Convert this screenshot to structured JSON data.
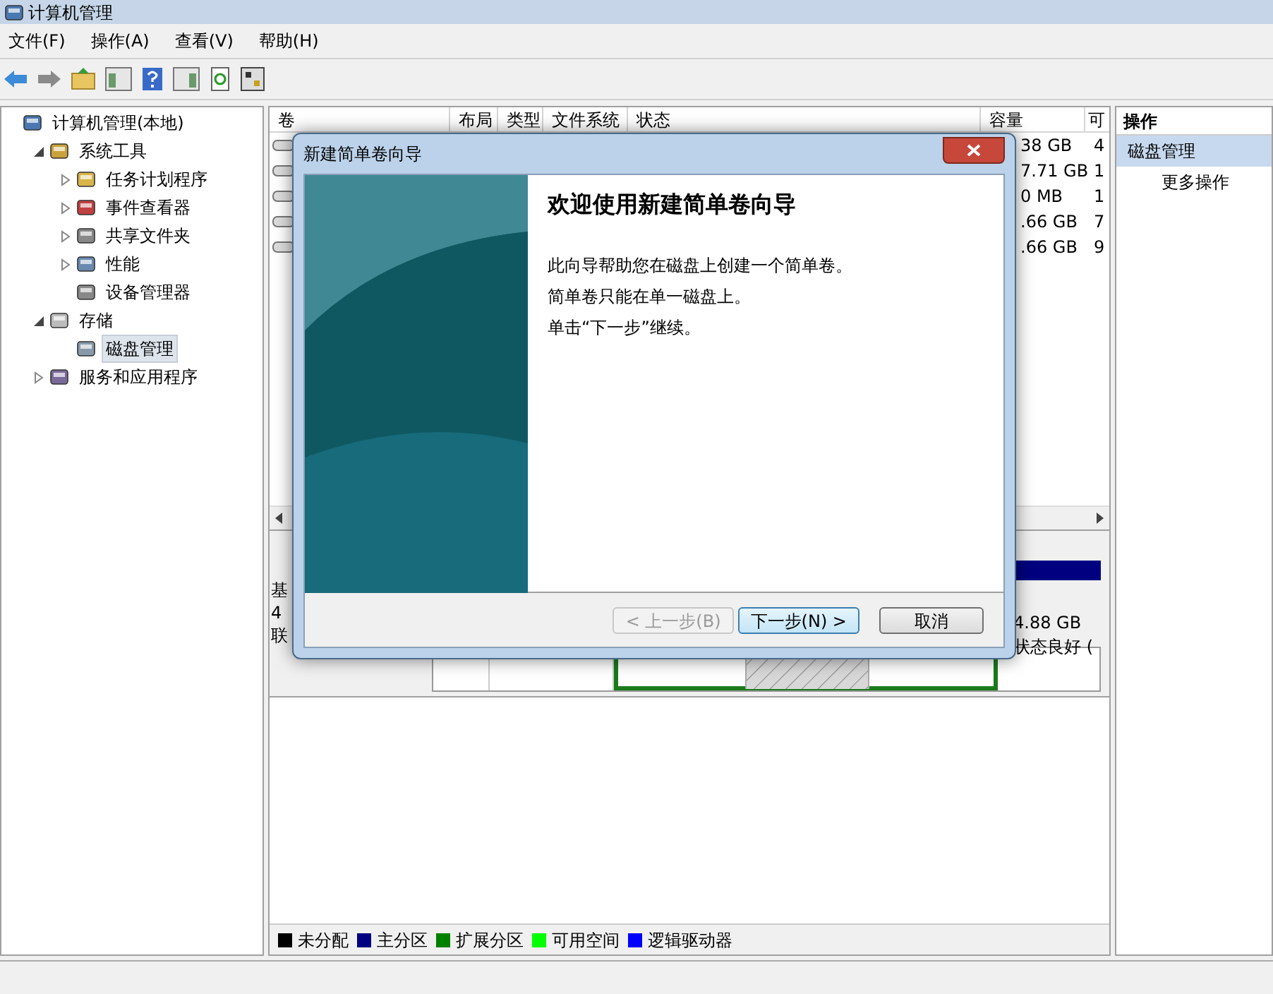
{
  "window": {
    "title": "计算机管理"
  },
  "menu": [
    "文件(F)",
    "操作(A)",
    "查看(V)",
    "帮助(H)"
  ],
  "tree": [
    {
      "label": "计算机管理(本地)",
      "selected": false,
      "children": [
        {
          "label": "系统工具",
          "expanded": true,
          "selected": false,
          "children": [
            {
              "label": "任务计划程序",
              "expanded": false,
              "selected": false
            },
            {
              "label": "事件查看器",
              "expanded": false,
              "selected": false
            },
            {
              "label": "共享文件夹",
              "expanded": false,
              "selected": false
            },
            {
              "label": "性能",
              "expanded": false,
              "selected": false
            },
            {
              "label": "设备管理器",
              "selected": false
            }
          ]
        },
        {
          "label": "存储",
          "expanded": true,
          "selected": false,
          "children": [
            {
              "label": "磁盘管理",
              "selected": true
            }
          ]
        },
        {
          "label": "服务和应用程序",
          "expanded": false,
          "selected": false
        }
      ]
    }
  ],
  "volume_table": {
    "columns": [
      "卷",
      "布局",
      "类型",
      "文件系统",
      "状态",
      "容量",
      "可"
    ],
    "rows": [
      {
        "capacity": "38 GB",
        "column_7": "4"
      },
      {
        "capacity": "7.71 GB",
        "column_7": "1"
      },
      {
        "capacity": "0 MB",
        "column_7": "1"
      },
      {
        "capacity": ".66 GB",
        "column_7": "7"
      },
      {
        "capacity": ".66 GB",
        "column_7": "9"
      }
    ]
  },
  "disk": {
    "label_lines": [
      "基",
      "4",
      "联"
    ],
    "partition_lines": [
      "4.88 GB",
      "状态良好 ("
    ]
  },
  "legend": [
    {
      "label": "未分配",
      "color": "#000000"
    },
    {
      "label": "主分区",
      "color": "#000080"
    },
    {
      "label": "扩展分区",
      "color": "#008000"
    },
    {
      "label": "可用空间",
      "color": "#00ff00"
    },
    {
      "label": "逻辑驱动器",
      "color": "#0000ff"
    }
  ],
  "actions": {
    "title": "操作",
    "items": [
      {
        "label": "磁盘管理",
        "kind": "header"
      },
      {
        "label": "更多操作",
        "kind": "item"
      }
    ]
  },
  "dialog": {
    "title": "新建简单卷向导",
    "heading": "欢迎使用新建简单卷向导",
    "paragraphs": [
      "此向导帮助您在磁盘上创建一个简单卷。",
      "简单卷只能在单一磁盘上。",
      "单击“下一步”继续。"
    ],
    "buttons": [
      {
        "label": "< 上一步(B)",
        "disabled": true,
        "focused": false
      },
      {
        "label": "下一步(N) >",
        "disabled": false,
        "focused": true
      },
      {
        "label": "取消",
        "disabled": false,
        "focused": false
      }
    ]
  }
}
